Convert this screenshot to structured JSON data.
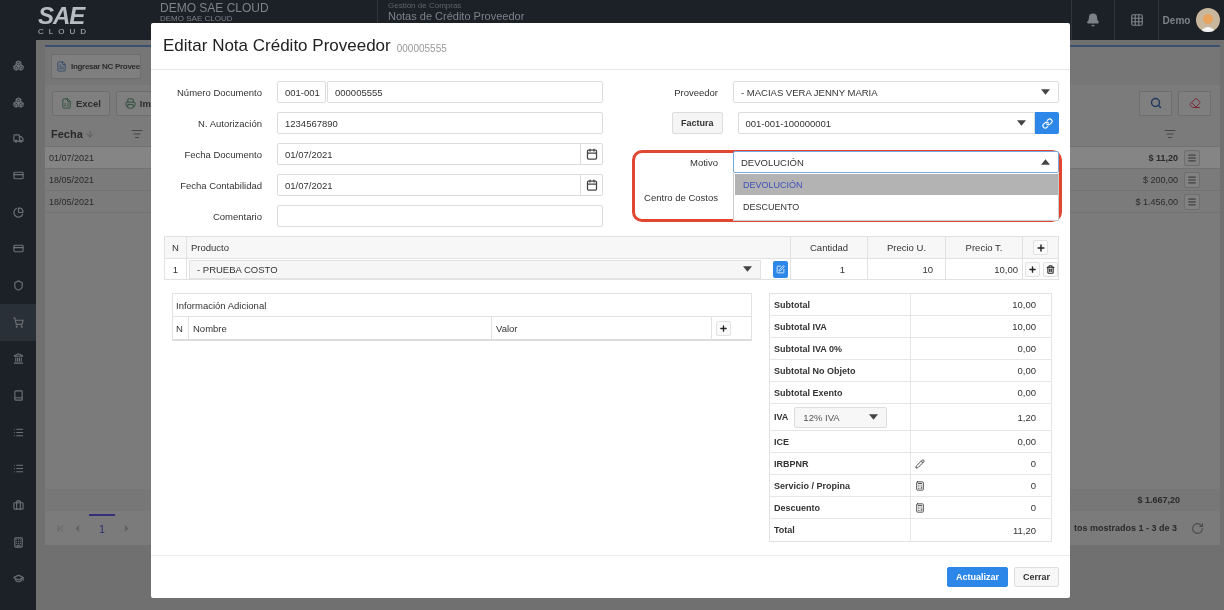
{
  "topbar": {
    "logo": {
      "main": "SAE",
      "sub": "CLOUD"
    },
    "company": "DEMO SAE CLOUD",
    "company_sub": "DEMO SAE CLOUD",
    "module": "Gestión de Compras",
    "page_title": "Notas de Crédito Proveedor",
    "user": "Demo"
  },
  "sidebar": {
    "items": [
      {
        "selected": false
      },
      {
        "selected": false
      },
      {
        "selected": false
      },
      {
        "selected": false
      },
      {
        "selected": false
      },
      {
        "selected": false
      },
      {
        "selected": false
      },
      {
        "selected": true
      },
      {
        "selected": false
      },
      {
        "selected": false
      },
      {
        "selected": false
      },
      {
        "selected": false
      },
      {
        "selected": false
      },
      {
        "selected": false
      },
      {
        "selected": false
      }
    ]
  },
  "list": {
    "new_button": "Ingresar NC Provee",
    "export_buttons": [
      "Excel",
      "Im"
    ],
    "sort_column": "Fecha",
    "rows": [
      {
        "date": "01/07/2021",
        "amount": "$ 11,20",
        "selected": true
      },
      {
        "date": "18/05/2021",
        "amount": "$ 200,00",
        "selected": false
      },
      {
        "date": "18/05/2021",
        "amount": "$ 1.456,00",
        "selected": false
      }
    ],
    "total": "$ 1.667,20",
    "pages": [
      {
        "label": "1",
        "selected": true
      }
    ],
    "records": "tos mostrados 1 - 3 de 3"
  },
  "modal": {
    "title": "Editar Nota Crédito Proveedor",
    "number": "000005555",
    "left_fields": [
      {
        "label": "Número Documento",
        "kind": "split",
        "prefix": "001-001",
        "value": "000005555"
      },
      {
        "label": "N. Autorización",
        "kind": "text",
        "value": "1234567890"
      },
      {
        "label": "Fecha Documento",
        "kind": "date",
        "value": "01/07/2021"
      },
      {
        "label": "Fecha Contabilidad",
        "kind": "date",
        "value": "01/07/2021"
      },
      {
        "label": "Comentario",
        "kind": "text"
      }
    ],
    "proveedor": {
      "label": "Proveedor",
      "value": "- MACIAS VERA JENNY MARIA"
    },
    "factura": {
      "button": "Factura",
      "value": "001-001-100000001"
    },
    "motivo": {
      "label": "Motivo",
      "value": "DEVOLUCIÓN",
      "expanded": true,
      "highlighted": true,
      "options": [
        {
          "label": "DEVOLUCIÓN",
          "selected": true
        },
        {
          "label": "DESCUENTO",
          "selected": false
        }
      ]
    },
    "centro_costos": {
      "label": "Centro de Costos"
    },
    "products": {
      "columns": [
        "N",
        "Producto",
        "Cantidad",
        "Precio U.",
        "Precio T."
      ],
      "rows": [
        {
          "n": "1",
          "product": "- PRUEBA COSTO",
          "quantity": "1",
          "unit_price": "10",
          "total_price": "10,00"
        }
      ]
    },
    "additional_info": {
      "title": "Información Adicional",
      "columns": [
        "N",
        "Nombre",
        "Valor"
      ]
    },
    "totals": [
      {
        "label": "Subtotal",
        "kind": "plain",
        "value": "10,00"
      },
      {
        "label": "Subtotal IVA",
        "kind": "plain",
        "value": "10,00"
      },
      {
        "label": "Subtotal IVA 0%",
        "kind": "plain",
        "value": "0,00"
      },
      {
        "label": "Subtotal No Objeto",
        "kind": "plain",
        "value": "0,00"
      },
      {
        "label": "Subtotal Exento",
        "kind": "plain",
        "value": "0,00"
      },
      {
        "label": "IVA",
        "kind": "select",
        "option": "12% IVA",
        "value": "1,20"
      },
      {
        "label": "ICE",
        "kind": "plain",
        "value": "0,00"
      },
      {
        "label": "IRBPNR",
        "kind": "edit",
        "value": "0"
      },
      {
        "label": "Servicio / Propina",
        "kind": "calc",
        "value": "0"
      },
      {
        "label": "Descuento",
        "kind": "calc",
        "value": "0"
      },
      {
        "label": "Total",
        "kind": "plain",
        "value": "11,20"
      }
    ],
    "buttons": [
      {
        "label": "Actualizar",
        "kind": "primary"
      },
      {
        "label": "Cerrar",
        "kind": "default"
      }
    ]
  }
}
